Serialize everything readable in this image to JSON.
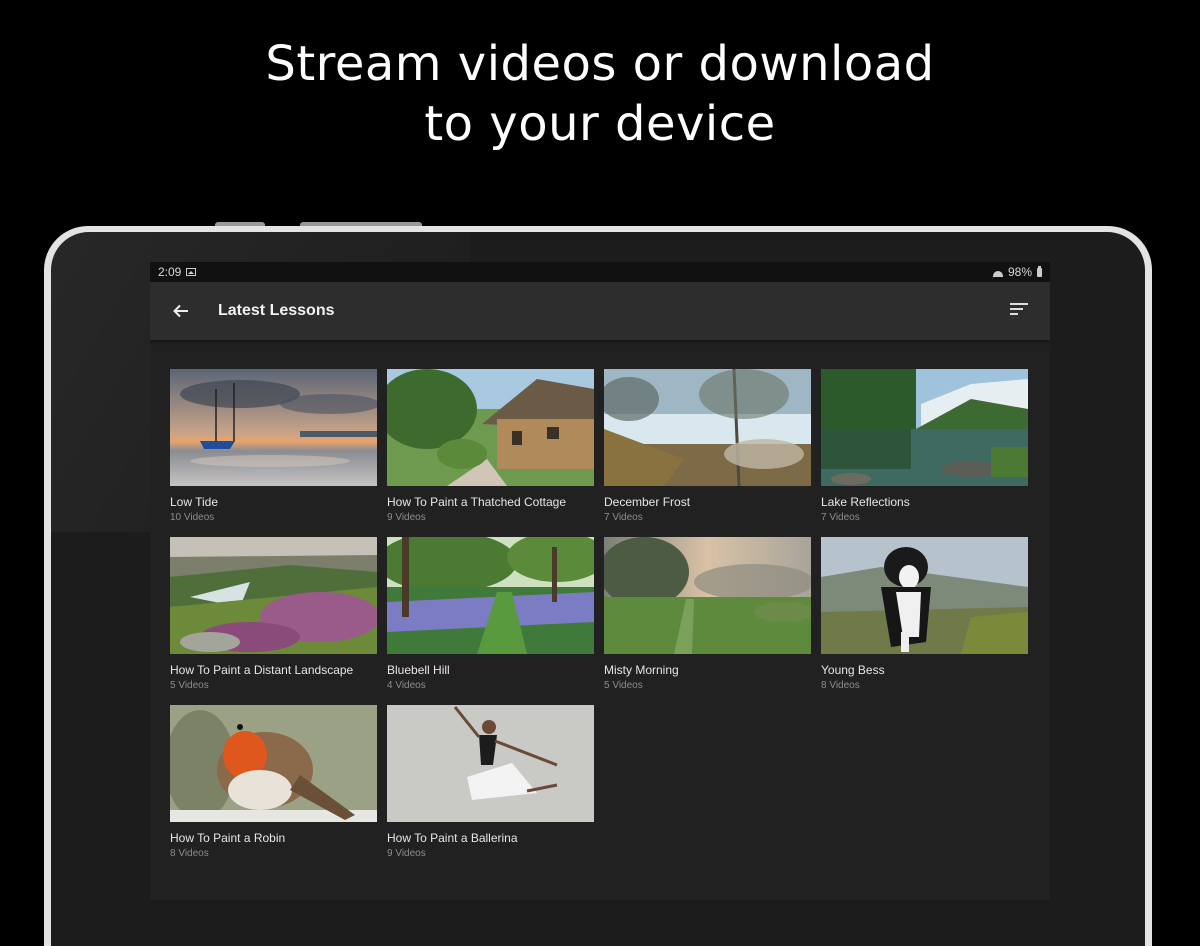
{
  "promo": {
    "headline_line1": "Stream videos or download",
    "headline_line2": "to your device"
  },
  "status_bar": {
    "time": "2:09",
    "battery": "98%"
  },
  "app_bar": {
    "title": "Latest Lessons",
    "back_icon": "arrow-left-icon",
    "sort_icon": "sort-icon"
  },
  "lessons": [
    {
      "title": "Low Tide",
      "count": "10 Videos"
    },
    {
      "title": "How To Paint a Thatched Cottage",
      "count": "9 Videos"
    },
    {
      "title": "December Frost",
      "count": "7 Videos"
    },
    {
      "title": "Lake Reflections",
      "count": "7 Videos"
    },
    {
      "title": "How To Paint a Distant Landscape",
      "count": "5 Videos"
    },
    {
      "title": "Bluebell Hill",
      "count": "4 Videos"
    },
    {
      "title": "Misty Morning",
      "count": "5 Videos"
    },
    {
      "title": "Young Bess",
      "count": "8 Videos"
    },
    {
      "title": "How To Paint a Robin",
      "count": "8 Videos"
    },
    {
      "title": "How To Paint a Ballerina",
      "count": "9 Videos"
    }
  ],
  "colors": {
    "background": "#000000",
    "screen": "#212121",
    "app_bar": "#2d2d2d"
  }
}
